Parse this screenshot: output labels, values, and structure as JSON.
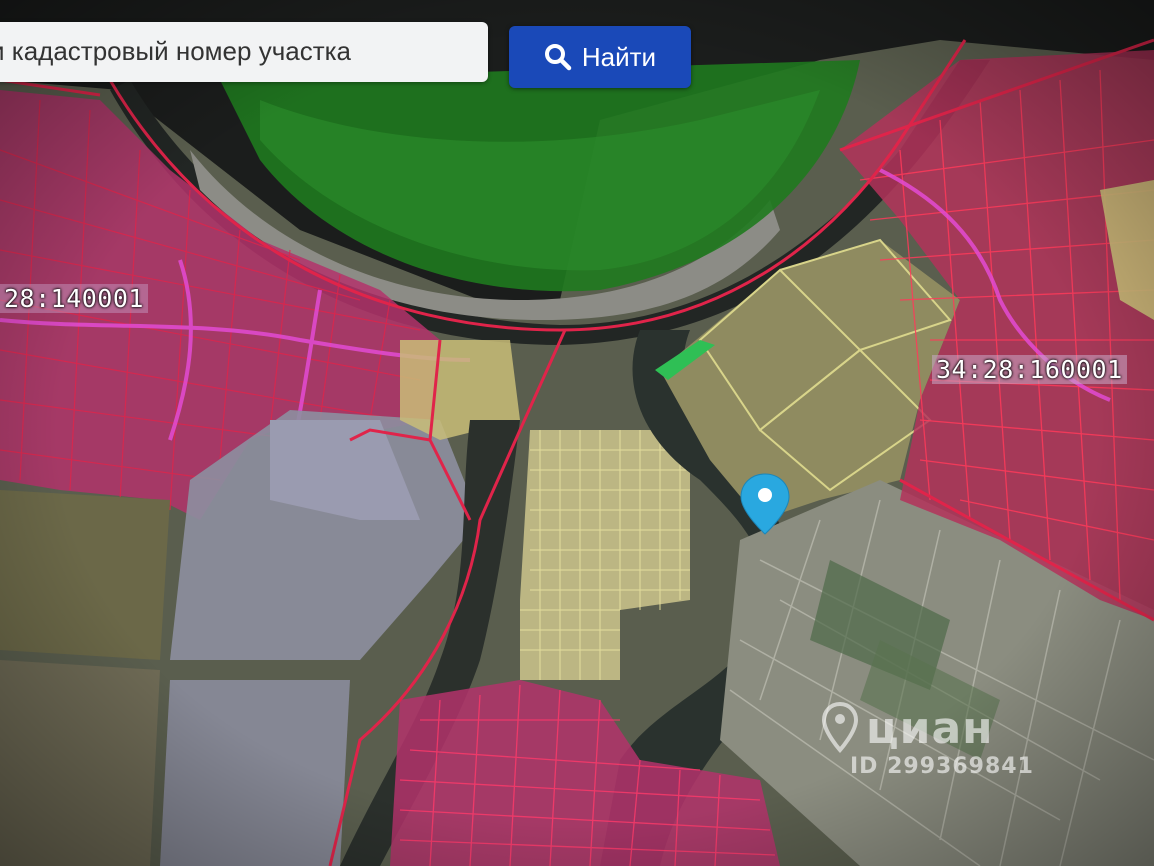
{
  "search": {
    "input_value": "и кадастровый номер участка",
    "button_label": "Найти",
    "button_icon": "search-icon",
    "button_color": "#1a49b8"
  },
  "map": {
    "parcel_labels": {
      "left": "28:140001",
      "right": "34:28:160001"
    },
    "colors": {
      "boundary_red": "#e0244a",
      "built_up_pink": "#c8287a",
      "agricultural_yellow": "#d8d48a",
      "forest_green": "#1f7a1f",
      "selected_parcel": "#2db36a",
      "pin": "#29a8e0"
    },
    "marker_icon": "map-pin-icon"
  },
  "watermark": {
    "brand": "циан",
    "listing_id": "ID 299369841",
    "icon": "cian-pin-icon"
  }
}
